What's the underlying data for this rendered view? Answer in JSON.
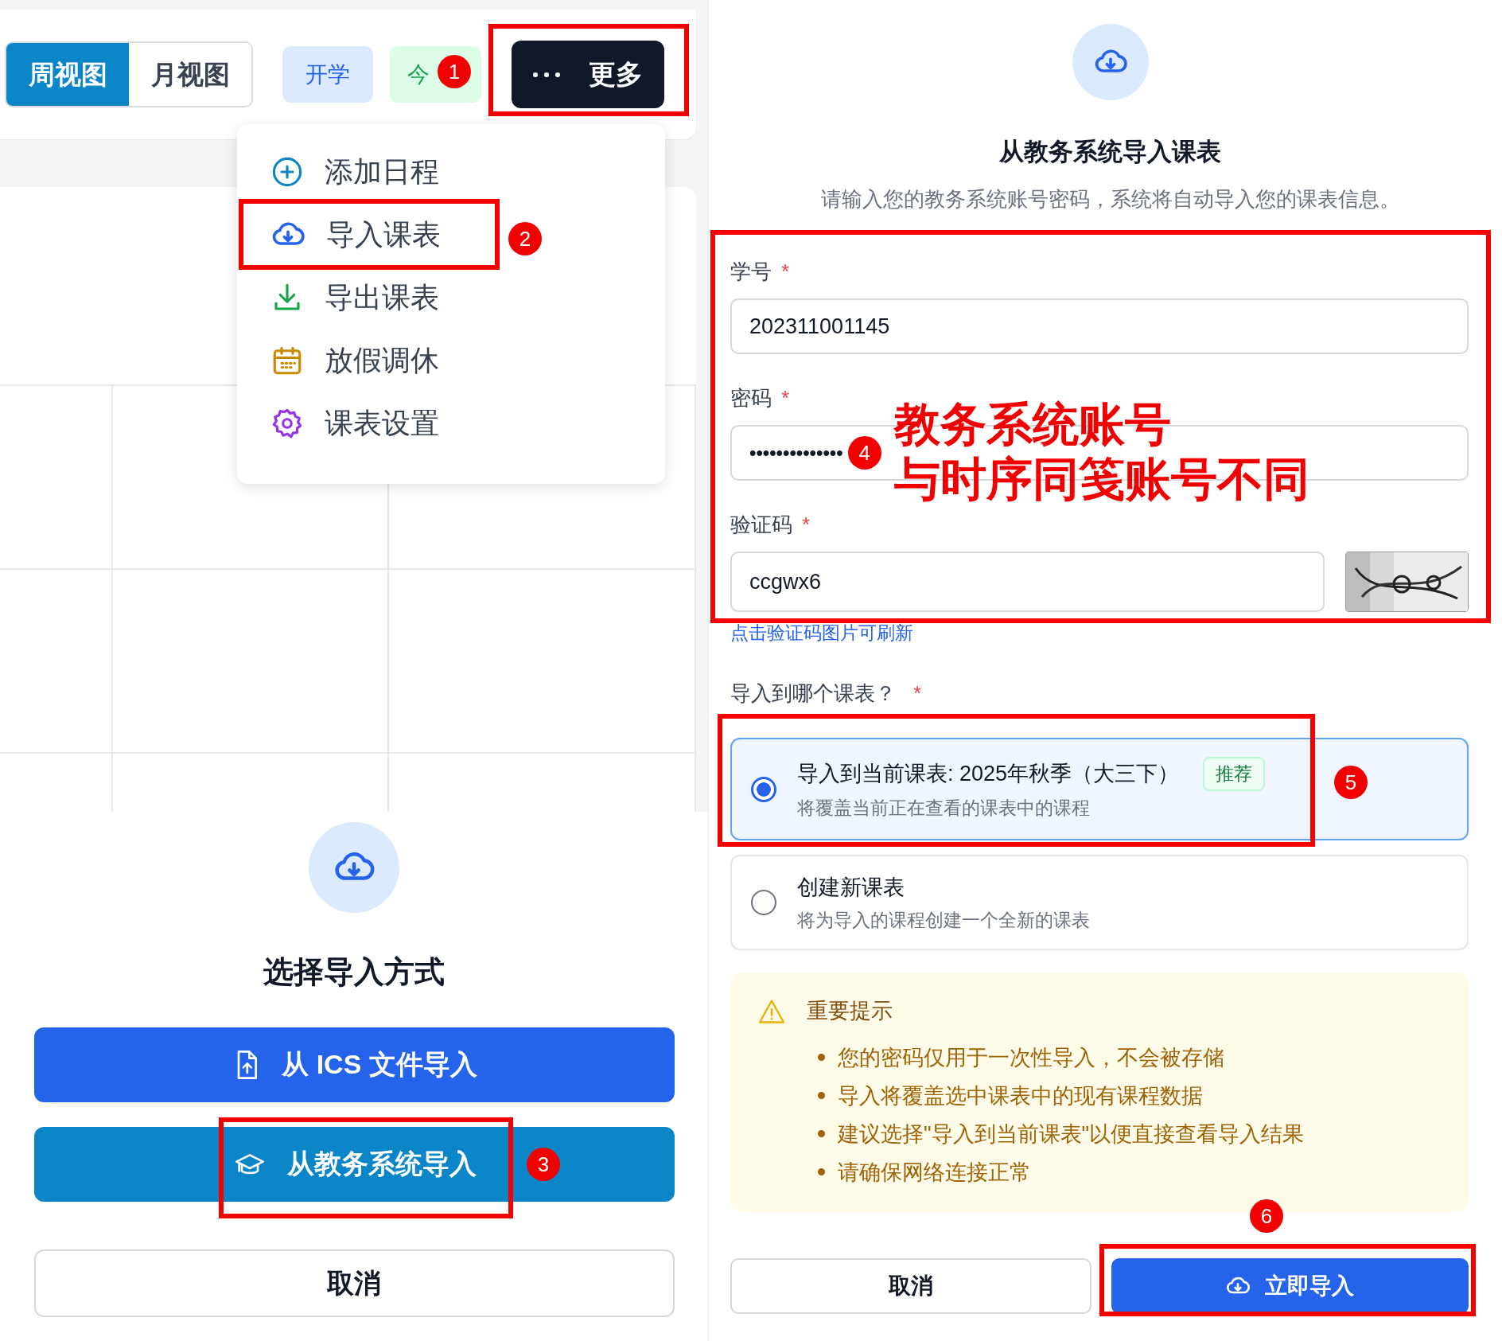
{
  "toolbar": {
    "view_tabs": [
      {
        "label": "周视图",
        "selected": true
      },
      {
        "label": "月视图",
        "selected": false
      }
    ],
    "chips": [
      {
        "label": "开学",
        "kind": "term"
      },
      {
        "label": "今",
        "kind": "today"
      }
    ],
    "more_button": {
      "label": "更多"
    }
  },
  "menu": {
    "items": [
      {
        "label": "添加日程",
        "kind": "add"
      },
      {
        "label": "导入课表",
        "kind": "import"
      },
      {
        "label": "导出课表",
        "kind": "export"
      },
      {
        "label": "放假调休",
        "kind": "holiday"
      },
      {
        "label": "课表设置",
        "kind": "settings"
      }
    ]
  },
  "import_method_dialog": {
    "title": "选择导入方式",
    "options": [
      {
        "label": "从 ICS 文件导入",
        "kind": "file"
      },
      {
        "label": "从教务系统导入",
        "kind": "school"
      }
    ],
    "cancel": "取消"
  },
  "import_form": {
    "title": "从教务系统导入课表",
    "subtitle": "请输入您的教务系统账号密码，系统将自动导入您的课表信息。",
    "fields": [
      {
        "label": "学号",
        "required_mark": "*",
        "value": "202311001145",
        "kind": "text"
      },
      {
        "label": "密码",
        "required_mark": "*",
        "value": "••••••••••••••",
        "kind": "password"
      },
      {
        "label": "验证码",
        "required_mark": "*",
        "value": "ccgwx6",
        "kind": "captcha"
      }
    ],
    "captcha_hint": "点击验证码图片可刷新",
    "target_label": "导入到哪个课表？",
    "target_required_mark": "*",
    "targets": [
      {
        "title": "导入到当前课表: 2025年秋季（大三下）",
        "description": "将覆盖当前正在查看的课表中的课程",
        "tag": "推荐",
        "selected": true
      },
      {
        "title": "创建新课表",
        "description": "将为导入的课程创建一个全新的课表",
        "selected": false
      }
    ],
    "notice": {
      "title": "重要提示",
      "items": [
        "您的密码仅用于一次性导入，不会被存储",
        "导入将覆盖选中课表中的现有课程数据",
        "建议选择\"导入到当前课表\"以便直接查看导入结果",
        "请确保网络连接正常"
      ]
    },
    "buttons": [
      {
        "label": "取消",
        "kind": "secondary"
      },
      {
        "label": "立即导入",
        "kind": "primary"
      }
    ]
  },
  "annotations": {
    "markers": [
      "1",
      "2",
      "3",
      "4",
      "5",
      "6"
    ],
    "note_lines": [
      "教务系统账号",
      "与时序同笺账号不同"
    ]
  }
}
